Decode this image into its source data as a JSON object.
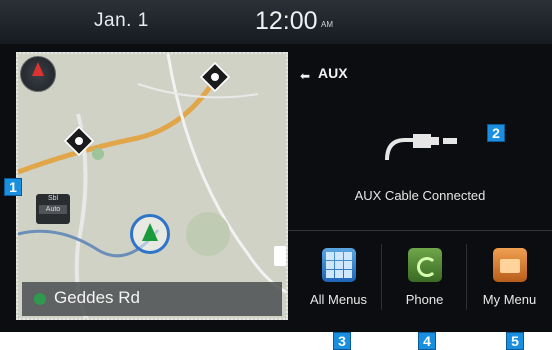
{
  "status": {
    "date": "Jan.  1",
    "time": "12:00",
    "ampm": "AM"
  },
  "map": {
    "street": "Geddes Rd",
    "speed_label_1": "Sbl",
    "speed_label_2": "Auto"
  },
  "aux": {
    "title": "AUX",
    "status": "AUX Cable Connected"
  },
  "menus": [
    {
      "label": "All Menus",
      "icon": "grid-icon"
    },
    {
      "label": "Phone",
      "icon": "phone-icon"
    },
    {
      "label": "My Menu",
      "icon": "folder-icon"
    }
  ],
  "badges": [
    "1",
    "2",
    "3",
    "4",
    "5"
  ],
  "colors": {
    "badge": "#1a8fe0",
    "background": "#0b0d10"
  }
}
